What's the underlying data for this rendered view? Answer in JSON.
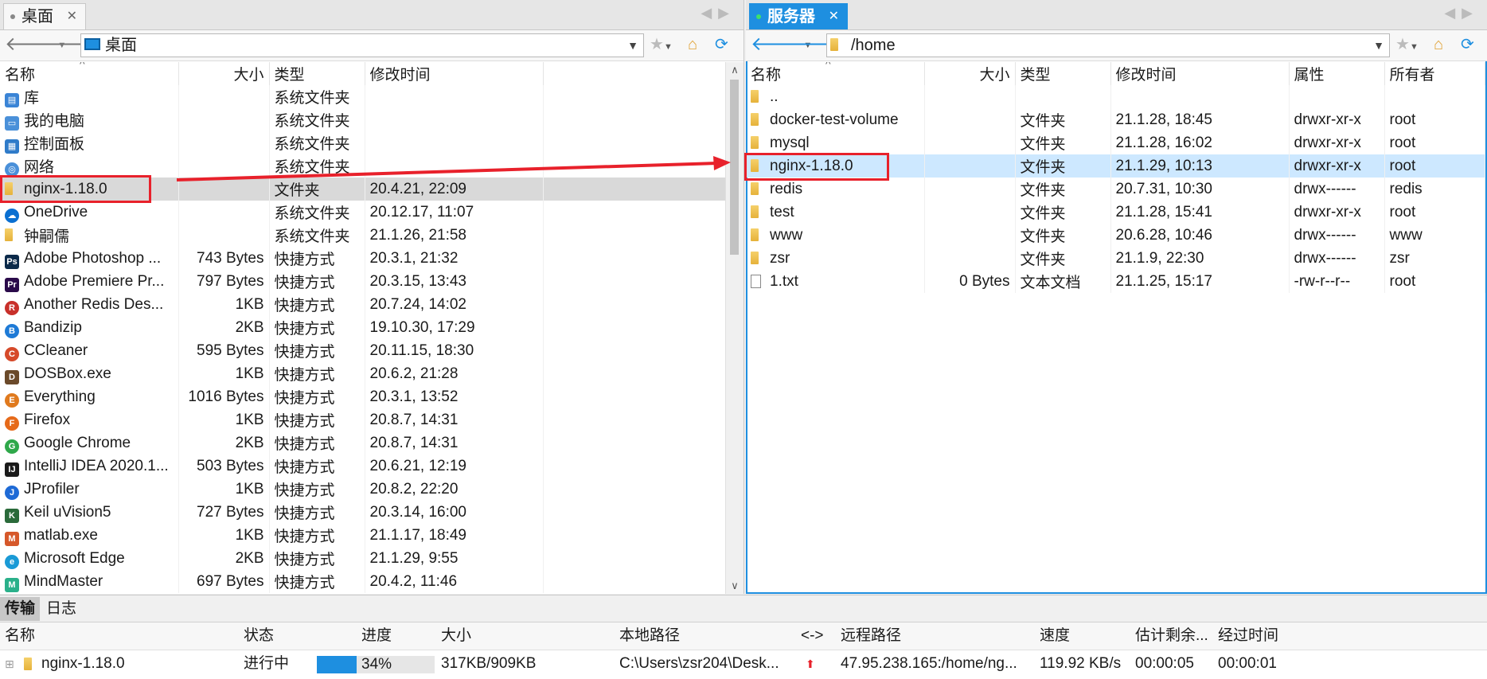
{
  "left_pane": {
    "tab_title": "桌面",
    "address": "桌面",
    "columns": {
      "name": "名称",
      "size": "大小",
      "type": "类型",
      "modified": "修改时间"
    },
    "rows": [
      {
        "name": "库",
        "size": "",
        "type": "系统文件夹",
        "modified": "",
        "icon": "library-icon"
      },
      {
        "name": "我的电脑",
        "size": "",
        "type": "系统文件夹",
        "modified": "",
        "icon": "computer-icon"
      },
      {
        "name": "控制面板",
        "size": "",
        "type": "系统文件夹",
        "modified": "",
        "icon": "control-panel-icon"
      },
      {
        "name": "网络",
        "size": "",
        "type": "系统文件夹",
        "modified": "",
        "icon": "network-icon"
      },
      {
        "name": "nginx-1.18.0",
        "size": "",
        "type": "文件夹",
        "modified": "20.4.21, 22:09",
        "icon": "folder-icon"
      },
      {
        "name": "OneDrive",
        "size": "",
        "type": "系统文件夹",
        "modified": "20.12.17, 11:07",
        "icon": "onedrive-icon"
      },
      {
        "name": "钟嗣儒",
        "size": "",
        "type": "系统文件夹",
        "modified": "21.1.26, 21:58",
        "icon": "user-folder-icon"
      },
      {
        "name": "Adobe Photoshop ...",
        "size": "743 Bytes",
        "type": "快捷方式",
        "modified": "20.3.1, 21:32",
        "icon": "photoshop-icon"
      },
      {
        "name": "Adobe Premiere Pr...",
        "size": "797 Bytes",
        "type": "快捷方式",
        "modified": "20.3.15, 13:43",
        "icon": "premiere-icon"
      },
      {
        "name": "Another Redis Des...",
        "size": "1KB",
        "type": "快捷方式",
        "modified": "20.7.24, 14:02",
        "icon": "redis-desktop-icon"
      },
      {
        "name": "Bandizip",
        "size": "2KB",
        "type": "快捷方式",
        "modified": "19.10.30, 17:29",
        "icon": "bandizip-icon"
      },
      {
        "name": "CCleaner",
        "size": "595 Bytes",
        "type": "快捷方式",
        "modified": "20.11.15, 18:30",
        "icon": "ccleaner-icon"
      },
      {
        "name": "DOSBox.exe",
        "size": "1KB",
        "type": "快捷方式",
        "modified": "20.6.2, 21:28",
        "icon": "dosbox-icon"
      },
      {
        "name": "Everything",
        "size": "1016 Bytes",
        "type": "快捷方式",
        "modified": "20.3.1, 13:52",
        "icon": "everything-icon"
      },
      {
        "name": "Firefox",
        "size": "1KB",
        "type": "快捷方式",
        "modified": "20.8.7, 14:31",
        "icon": "firefox-icon"
      },
      {
        "name": "Google Chrome",
        "size": "2KB",
        "type": "快捷方式",
        "modified": "20.8.7, 14:31",
        "icon": "chrome-icon"
      },
      {
        "name": "IntelliJ IDEA 2020.1...",
        "size": "503 Bytes",
        "type": "快捷方式",
        "modified": "20.6.21, 12:19",
        "icon": "intellij-icon"
      },
      {
        "name": "JProfiler",
        "size": "1KB",
        "type": "快捷方式",
        "modified": "20.8.2, 22:20",
        "icon": "jprofiler-icon"
      },
      {
        "name": "Keil uVision5",
        "size": "727 Bytes",
        "type": "快捷方式",
        "modified": "20.3.14, 16:00",
        "icon": "keil-icon"
      },
      {
        "name": "matlab.exe",
        "size": "1KB",
        "type": "快捷方式",
        "modified": "21.1.17, 18:49",
        "icon": "matlab-icon"
      },
      {
        "name": "Microsoft Edge",
        "size": "2KB",
        "type": "快捷方式",
        "modified": "21.1.29, 9:55",
        "icon": "edge-icon"
      },
      {
        "name": "MindMaster",
        "size": "697 Bytes",
        "type": "快捷方式",
        "modified": "20.4.2, 11:46",
        "icon": "mindmaster-icon"
      }
    ]
  },
  "right_pane": {
    "tab_title": "服务器",
    "address": "/home",
    "columns": {
      "name": "名称",
      "size": "大小",
      "type": "类型",
      "modified": "修改时间",
      "perms": "属性",
      "owner": "所有者"
    },
    "rows": [
      {
        "name": "..",
        "size": "",
        "type": "",
        "modified": "",
        "perms": "",
        "owner": "",
        "icon": "folder-icon"
      },
      {
        "name": "docker-test-volume",
        "size": "",
        "type": "文件夹",
        "modified": "21.1.28, 18:45",
        "perms": "drwxr-xr-x",
        "owner": "root",
        "icon": "folder-icon"
      },
      {
        "name": "mysql",
        "size": "",
        "type": "文件夹",
        "modified": "21.1.28, 16:02",
        "perms": "drwxr-xr-x",
        "owner": "root",
        "icon": "folder-icon"
      },
      {
        "name": "nginx-1.18.0",
        "size": "",
        "type": "文件夹",
        "modified": "21.1.29, 10:13",
        "perms": "drwxr-xr-x",
        "owner": "root",
        "icon": "folder-icon"
      },
      {
        "name": "redis",
        "size": "",
        "type": "文件夹",
        "modified": "20.7.31, 10:30",
        "perms": "drwx------",
        "owner": "redis",
        "icon": "folder-icon"
      },
      {
        "name": "test",
        "size": "",
        "type": "文件夹",
        "modified": "21.1.28, 15:41",
        "perms": "drwxr-xr-x",
        "owner": "root",
        "icon": "folder-icon"
      },
      {
        "name": "www",
        "size": "",
        "type": "文件夹",
        "modified": "20.6.28, 10:46",
        "perms": "drwx------",
        "owner": "www",
        "icon": "folder-icon"
      },
      {
        "name": "zsr",
        "size": "",
        "type": "文件夹",
        "modified": "21.1.9, 22:30",
        "perms": "drwx------",
        "owner": "zsr",
        "icon": "folder-icon"
      },
      {
        "name": "1.txt",
        "size": "0 Bytes",
        "type": "文本文档",
        "modified": "21.1.25, 15:17",
        "perms": "-rw-r--r--",
        "owner": "root",
        "icon": "text-file-icon"
      }
    ]
  },
  "bottom": {
    "tabs": [
      "传输",
      "日志"
    ],
    "columns": {
      "name": "名称",
      "status": "状态",
      "progress": "进度",
      "size": "大小",
      "local": "本地路径",
      "direction": "<->",
      "remote": "远程路径",
      "speed": "速度",
      "eta": "估计剩余...",
      "elapsed": "经过时间"
    },
    "transfer": {
      "name": "nginx-1.18.0",
      "status": "进行中",
      "progress_text": "34%",
      "progress_value": 0.34,
      "size": "317KB/909KB",
      "local": "C:\\Users\\zsr204\\Desk...",
      "remote": "47.95.238.165:/home/ng...",
      "speed": "119.92 KB/s",
      "eta": "00:00:05",
      "elapsed": "00:00:01"
    }
  },
  "colors": {
    "accent": "#1e8fe0",
    "highlight": "#e8212b",
    "selection_blue": "#cde8ff",
    "selection_gray": "#d9d9d9"
  }
}
